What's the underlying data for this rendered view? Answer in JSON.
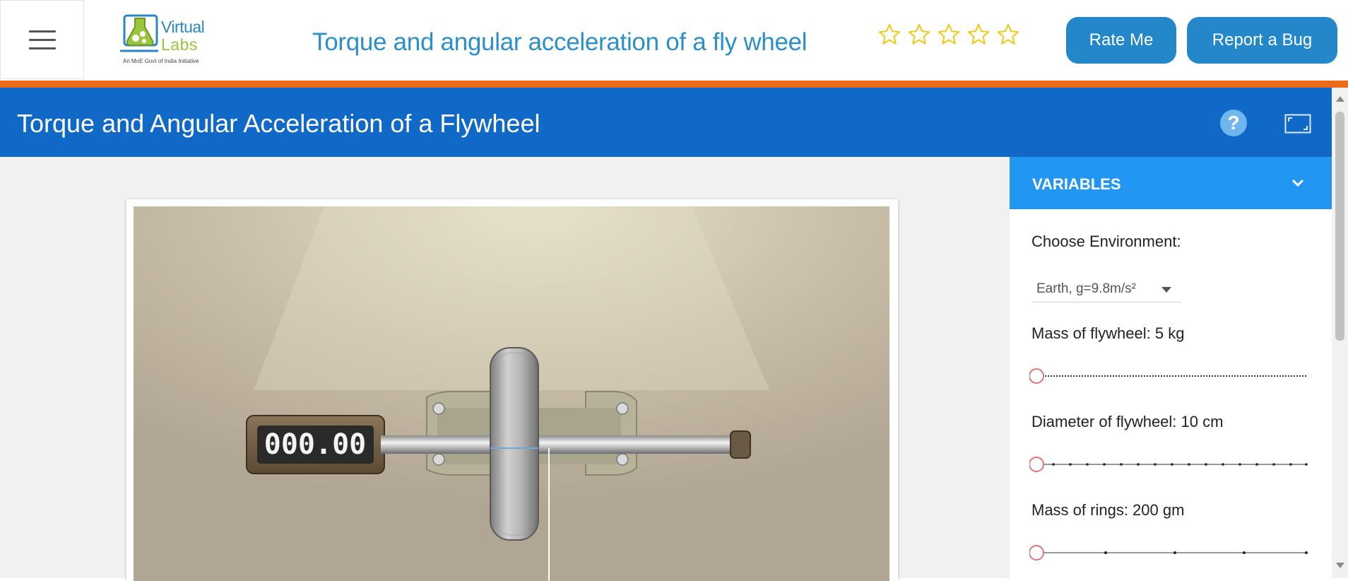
{
  "header": {
    "menu_icon": "hamburger-menu-icon",
    "logo": {
      "word1": "Virtual",
      "word2": "Labs",
      "tagline": "An MoE Govt of India Initiative"
    },
    "experiment_title": "Torque and angular acceleration of a fly wheel",
    "rating": {
      "stars": 5,
      "filled": 0,
      "star_color": "#f2c811"
    },
    "rate_button": "Rate Me",
    "bug_button": "Report a Bug"
  },
  "colors": {
    "accent_orange": "#ee6a1b",
    "title_bar": "#1069c7",
    "panel_header": "#2196f3",
    "button_blue": "#2487c9"
  },
  "simulation": {
    "title": "Torque and Angular Acceleration of a Flywheel",
    "help_icon": "question-mark-icon",
    "fullscreen_icon": "fullscreen-icon",
    "counter_display": "000.00"
  },
  "variables": {
    "header": "VARIABLES",
    "environment": {
      "label": "Choose Environment:",
      "selected": "Earth, g=9.8m/s²"
    },
    "mass_flywheel": {
      "label": "Mass of flywheel: 5 kg",
      "value": 0
    },
    "diameter_flywheel": {
      "label": "Diameter of flywheel: 10 cm",
      "value": 0
    },
    "mass_rings": {
      "label": "Mass of rings: 200 gm",
      "value": 0
    }
  }
}
